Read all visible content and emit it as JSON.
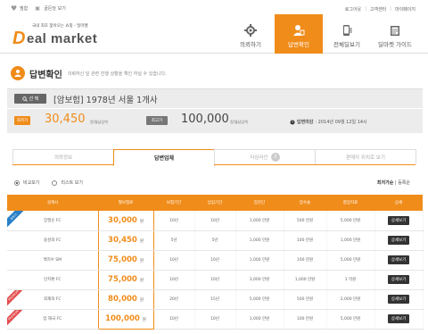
{
  "util": {
    "left": [
      "찜함",
      "골든당 보기"
    ],
    "right": [
      "로그아웃",
      "고객센터",
      "마이페이지"
    ]
  },
  "logo": {
    "tagline": "국내 최초 찾아오는 쇼핑 - 딜마켓",
    "text": "eal market"
  },
  "nav": [
    {
      "label": "의뢰하기",
      "icon": "gear-icon",
      "active": false
    },
    {
      "label": "답변확인",
      "icon": "person-icon",
      "active": true
    },
    {
      "label": "전체딜보기",
      "icon": "phone-icon",
      "active": false
    },
    {
      "label": "딜마켓 가이드",
      "icon": "book-icon",
      "active": false
    }
  ],
  "page": {
    "title": "답변확인",
    "subtitle": "의뢰하신 딜 관련 진행 상황을 확인 하실 수 있습니다."
  },
  "info": {
    "search_label": "선 택",
    "product": "[암보험] 1978년 서울 1개사",
    "min_label": "최저가",
    "min_value": "30,450",
    "min_unit": "원/월납입액",
    "max_label": "최고가",
    "max_value": "100,000",
    "max_unit": "원/월납입액",
    "deadline_label": "답변마감",
    "deadline_value": ": 2014년 09월 12일 14시"
  },
  "tabs": [
    {
      "label": "의뢰정보",
      "active": false
    },
    {
      "label": "답변업체",
      "active": true
    },
    {
      "label": "타임라인",
      "active": false,
      "badge": "3"
    },
    {
      "label": "판매자 위치로 보기",
      "active": false
    }
  ],
  "view": {
    "compare": "비교보기",
    "list": "리스트 보기",
    "sort_label": "최저가순",
    "sort_other": "등록순"
  },
  "table": {
    "headers": [
      "설계사",
      "월보험료",
      "보험기간",
      "납입기간",
      "암진단",
      "암수술",
      "항암치료",
      "상세"
    ],
    "rows": [
      {
        "name": "장필순 FC",
        "price": "30,000",
        "term": "10년",
        "pay": "10년",
        "diag": "1,000 만원",
        "surg": "500 만원",
        "chemo": "5,000 만원",
        "ribbon": "최저가",
        "ribbon_color": "blue"
      },
      {
        "name": "용성희 FC",
        "price": "30,450",
        "term": "5년",
        "pay": "5년",
        "diag": "1,000 만원",
        "surg": "100 만원",
        "chemo": "1,000 만원",
        "ribbon": "",
        "ribbon_color": ""
      },
      {
        "name": "백지수 SM",
        "price": "75,000",
        "term": "10년",
        "pay": "10년",
        "diag": "1,000 만원",
        "surg": "100 만원",
        "chemo": "5,000 만원",
        "ribbon": "",
        "ribbon_color": ""
      },
      {
        "name": "인지환 FC",
        "price": "75,000",
        "term": "10년",
        "pay": "10년",
        "diag": "3,000 만원",
        "surg": "1,000 만원",
        "chemo": "1 억원",
        "ribbon": "",
        "ribbon_color": ""
      },
      {
        "name": "최재희 FC",
        "price": "80,000",
        "term": "20년",
        "pay": "15년",
        "diag": "5,000 만원",
        "surg": "500 만원",
        "chemo": "2,000 만원",
        "ribbon": "PREMIUM",
        "ribbon_color": "red"
      },
      {
        "name": "엄 재국 FC",
        "price": "100,000",
        "term": "10년",
        "pay": "10년",
        "diag": "1,000 만원",
        "surg": "100 만원",
        "chemo": "5,000 만원",
        "ribbon": "PREMIUM",
        "ribbon_color": "red"
      }
    ],
    "price_unit": "원",
    "detail_label": "상세보기"
  },
  "colors": {
    "accent": "#f08c1a",
    "dark": "#333333"
  }
}
